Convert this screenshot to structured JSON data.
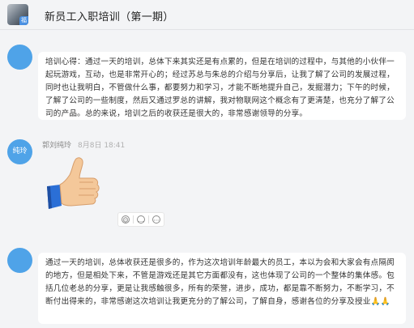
{
  "header": {
    "title": "新员工入职培训（第一期）",
    "avatar_badge": "福"
  },
  "messages": [
    {
      "sender": "",
      "avatar_text": "",
      "avatar_color": "#4fa3e8",
      "text": "培训心得：通过一天的培训，总体下来其实还是有点累的，但是在培训的过程中，与其他的小伙伴一起玩游戏，互动，也是非常开心的；经过苏总与朱总的介绍与分享后，让我了解了公司的发展过程，同时也让我明白，不管做什么事，都要努力和学习，才能不断地提升自己，发掘潜力；下午的时候，了解了公司的一些制度，然后又通过罗总的讲解，我对物联网这个概念有了更清楚，也充分了解了公司的产品。总的来说，培训之后的收获还是很大的，非常感谢领导的分享。"
    },
    {
      "sender": "郭刘纯玲",
      "time": "8月8日 18:41",
      "avatar_text": "纯玲",
      "avatar_color": "#4fa3e8",
      "sticker": "thumbs-up",
      "actions": [
        "emoji-reaction",
        "reply",
        "more"
      ]
    },
    {
      "sender": "",
      "avatar_text": "",
      "avatar_color": "#4fa3e8",
      "text": "通过一天的培训，总体收获还是很多的，作为这次培训年龄最大的员工，本以为会和大家会有点隔阂的地方，但是相处下来，不管是游戏还是其它方面都没有，这也体现了公司的一个整体的集体感。包括几位老总的分享，更是让我感触很多，所有的荣誉，进步，成功，都是靠不断努力，不断学习，不断付出得来的，非常感谢这次培训让我更充分的了解公司，了解自身，感谢各位的分享及授业",
      "emoji_suffix": "🙏🙏"
    }
  ]
}
